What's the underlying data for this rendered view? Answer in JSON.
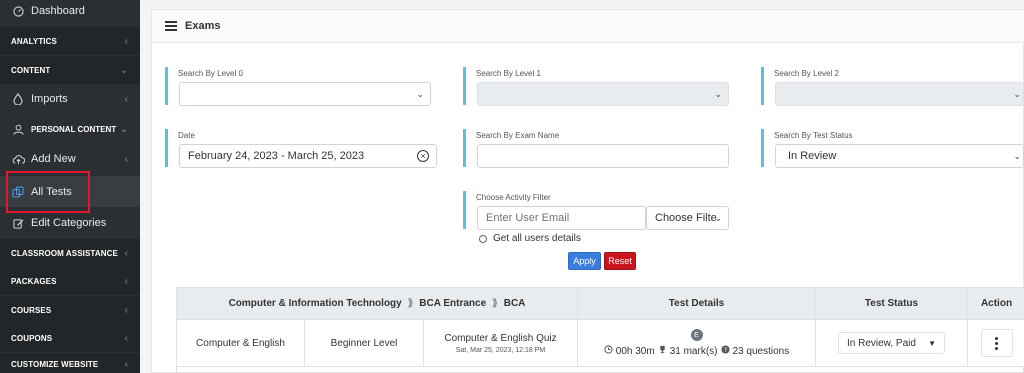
{
  "sidebar": {
    "dashboard": "Dashboard",
    "analytics": "ANALYTICS",
    "content": "CONTENT",
    "imports": "Imports",
    "personal_content": "PERSONAL CONTENT",
    "add_new": "Add New",
    "all_tests": "All Tests",
    "edit_categories": "Edit Categories",
    "classroom_assistance": "CLASSROOM ASSISTANCE",
    "packages": "PACKAGES",
    "courses": "COURSES",
    "coupons": "COUPONS",
    "customize_website": "CUSTOMIZE WEBSITE"
  },
  "panel": {
    "title": "Exams"
  },
  "filters": {
    "level0_label": "Search By Level 0",
    "level1_label": "Search By Level 1",
    "level2_label": "Search By Level 2",
    "date_label": "Date",
    "date_value": "February 24, 2023 - March 25, 2023",
    "exam_name_label": "Search By Exam Name",
    "exam_name_value": "",
    "test_status_label": "Search By Test Status",
    "test_status_value": "In Review",
    "activity_label": "Choose Activity Filter",
    "email_placeholder": "Enter User Email",
    "filter_select": "Choose Filte",
    "all_users": "Get all users details",
    "apply": "Apply",
    "reset": "Reset"
  },
  "table": {
    "headers": {
      "category": [
        "Computer & Information Technology",
        "BCA Entrance",
        "BCA"
      ],
      "test_details": "Test Details",
      "test_status": "Test Status",
      "action": "Action"
    },
    "rows": [
      {
        "subject": "Computer & English",
        "level": "Beginner Level",
        "quiz_name": "Computer & English Quiz",
        "quiz_date": "Sat, Mar 25, 2023, 12:18 PM",
        "badge": "E",
        "duration": "00h 30m",
        "marks": "31 mark(s)",
        "questions": "23 questions",
        "status": "In Review, Paid"
      }
    ]
  },
  "colors": {
    "accent_border": "#5bc0de",
    "apply": "#3b7ddd",
    "reset": "#c9151e",
    "highlight": "#e0192c",
    "sidebar": "#2b2f33"
  }
}
